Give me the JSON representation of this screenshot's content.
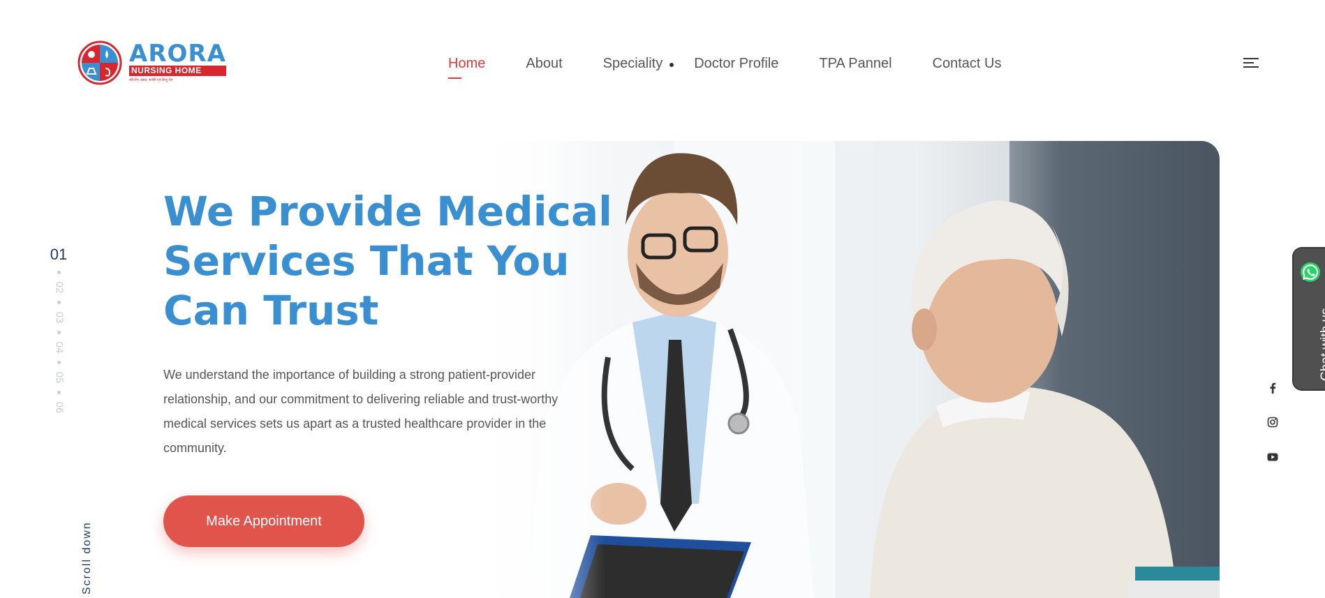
{
  "logo": {
    "name": "ARORA",
    "subtitle": "NURSING HOME",
    "tagline": "स्त्री रोग, प्रसव, सर्जरी एवं शिशु रोग"
  },
  "nav": {
    "items": [
      {
        "label": "Home",
        "active": true
      },
      {
        "label": "About",
        "active": false
      },
      {
        "label": "Speciality",
        "active": false
      },
      {
        "label": "Doctor Profile",
        "active": false
      },
      {
        "label": "TPA Pannel",
        "active": false
      },
      {
        "label": "Contact Us",
        "active": false
      }
    ]
  },
  "slider": {
    "current": "01",
    "others": [
      "02",
      "03",
      "04",
      "05",
      "06"
    ],
    "scroll_label": "Scroll down"
  },
  "hero": {
    "headline": [
      "We Provide Medical",
      "Services That You",
      "Can Trust"
    ],
    "lead": "We understand the importance of building a strong patient-provider relationship, and our commitment to delivering reliable and trust-worthy medical services sets us apart as a trusted healthcare provider in the community.",
    "cta_label": "Make Appointment"
  },
  "chat": {
    "label": "Chat with us"
  },
  "social": [
    "facebook-icon",
    "instagram-icon",
    "youtube-icon"
  ],
  "colors": {
    "brand_blue": "#3a8fd1",
    "brand_red": "#d7262d",
    "accent": "#e0544c",
    "nav_active": "#dd3a3a",
    "navy": "#1b3a6b"
  }
}
